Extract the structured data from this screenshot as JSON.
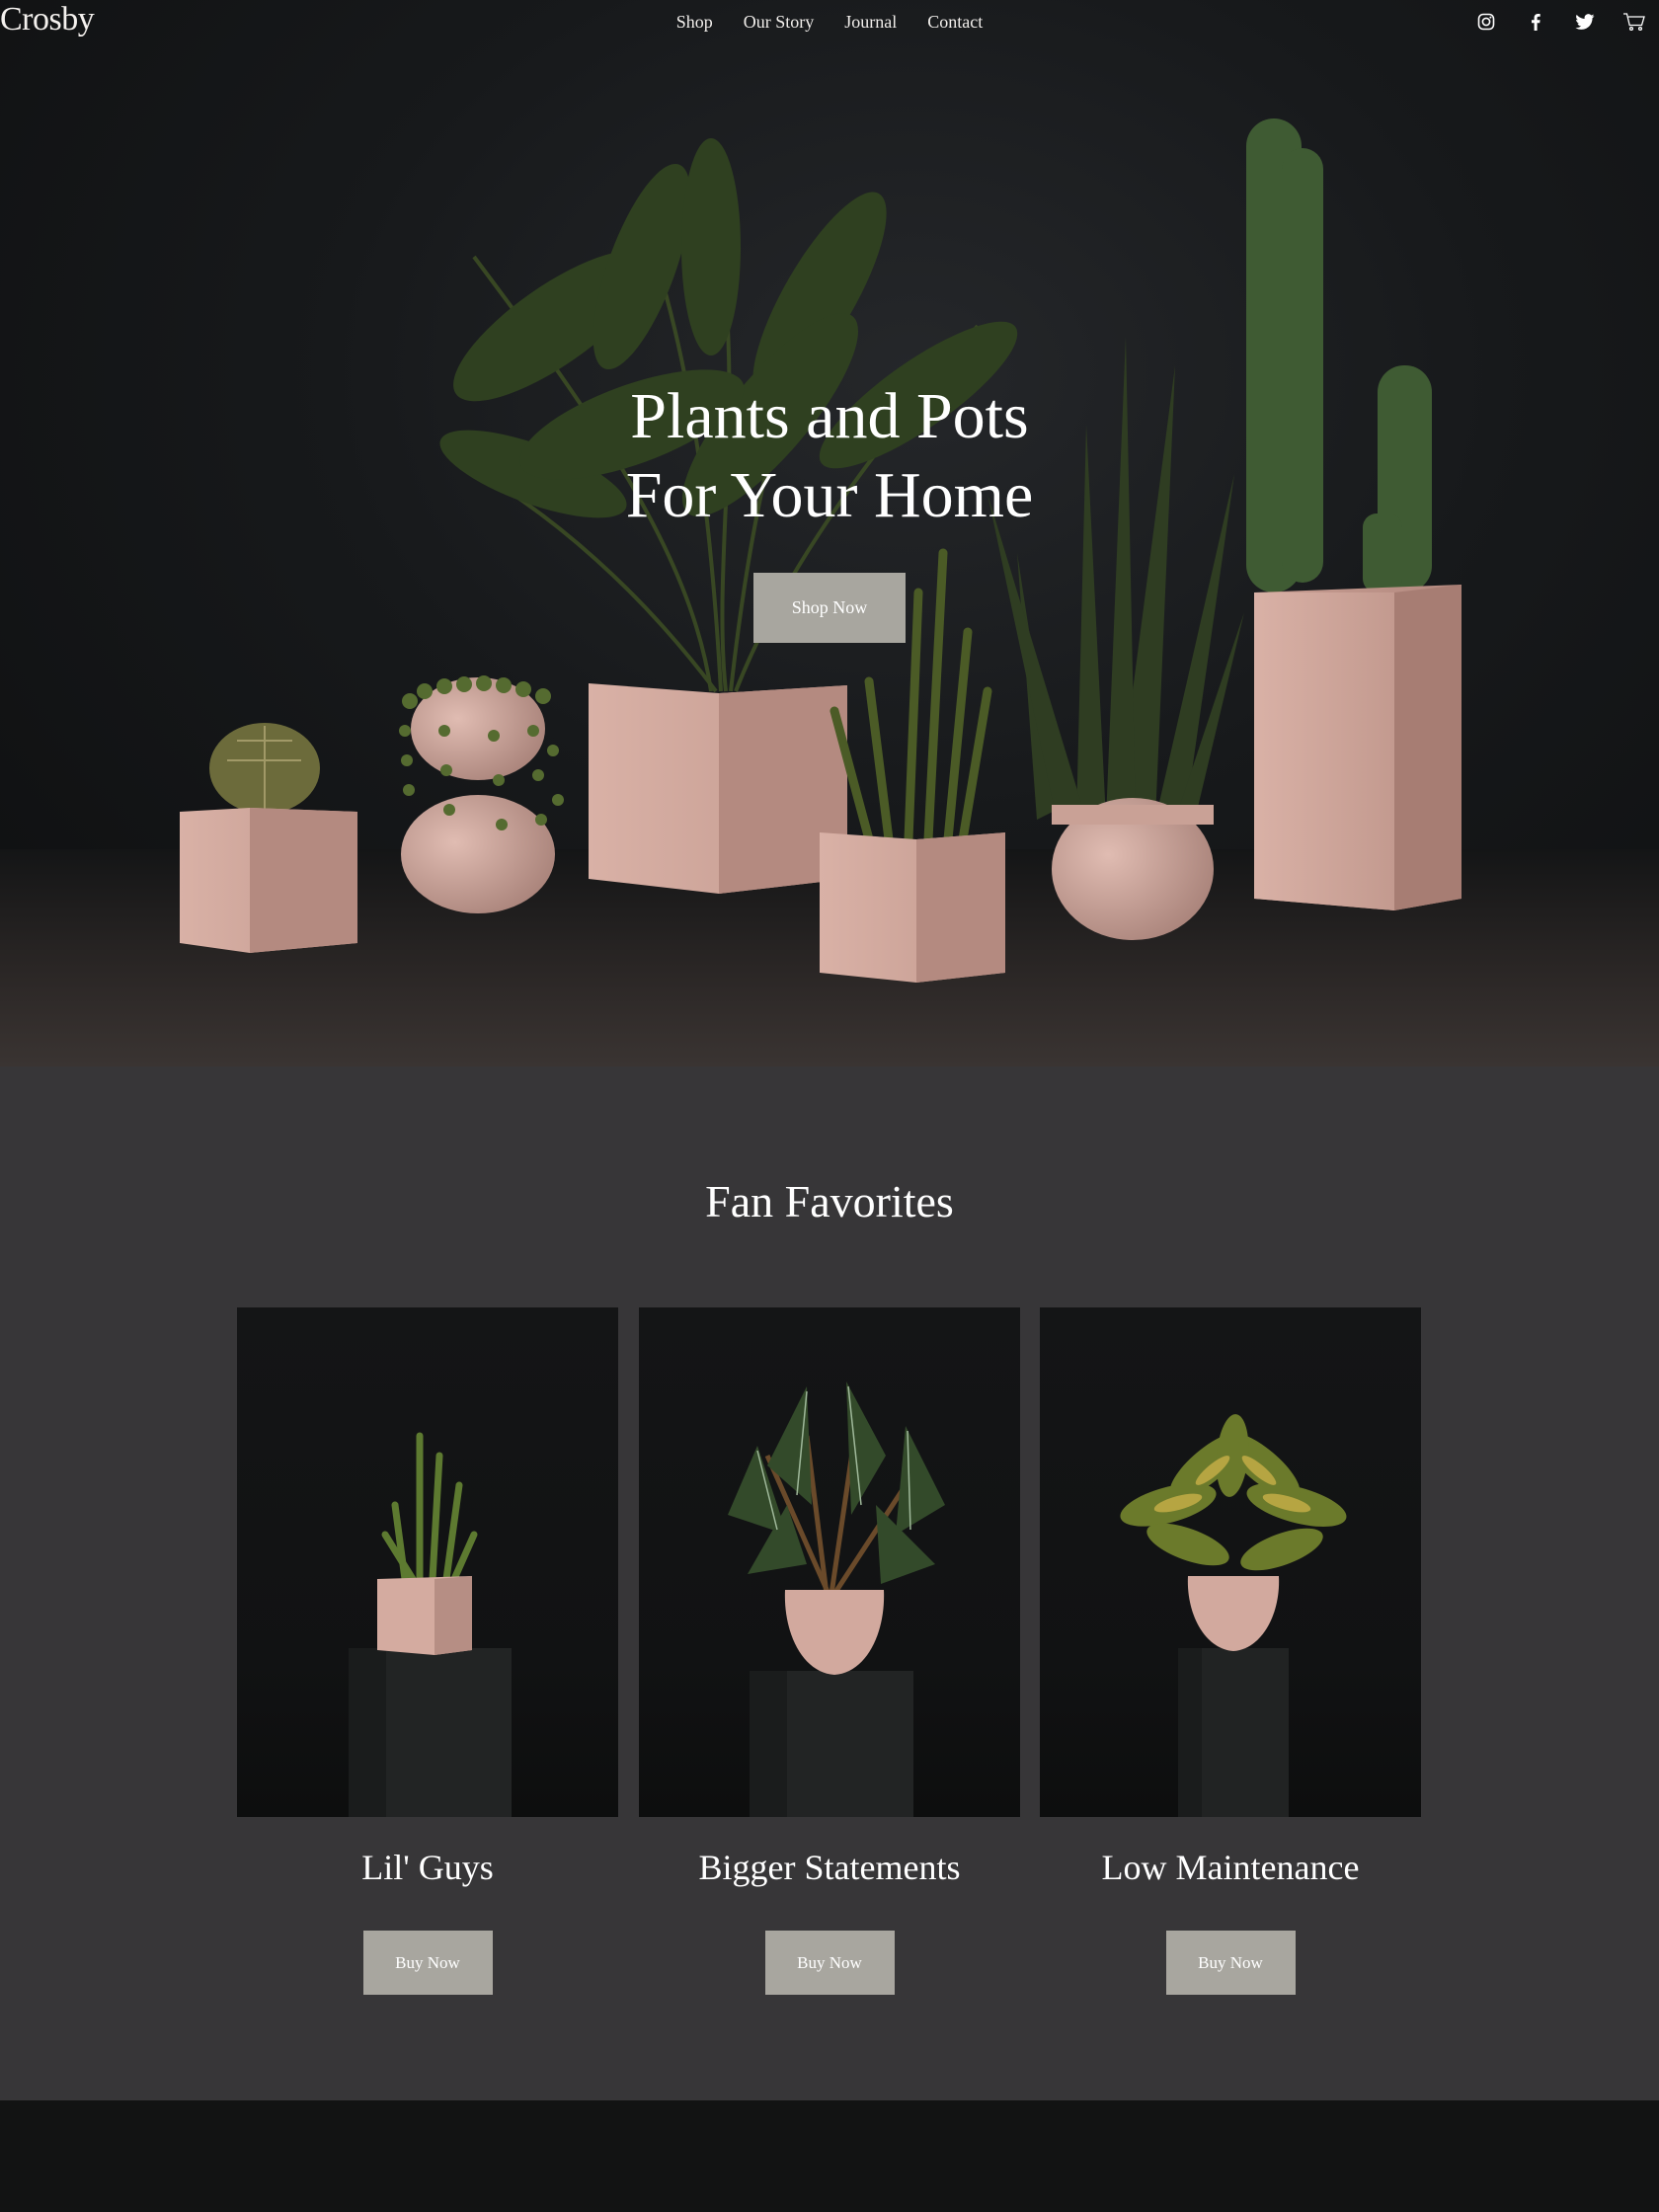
{
  "brand": {
    "name": "Crosby"
  },
  "nav": {
    "items": [
      {
        "label": "Shop"
      },
      {
        "label": "Our Story"
      },
      {
        "label": "Journal"
      },
      {
        "label": "Contact"
      }
    ]
  },
  "social": {
    "icons": [
      "instagram-icon",
      "facebook-icon",
      "twitter-icon",
      "cart-icon"
    ]
  },
  "hero": {
    "title_line1": "Plants and Pots",
    "title_line2": "For Your Home",
    "cta_label": "Shop Now"
  },
  "favorites": {
    "title": "Fan Favorites",
    "cards": [
      {
        "name": "Lil' Guys",
        "cta_label": "Buy Now"
      },
      {
        "name": "Bigger Statements",
        "cta_label": "Buy Now"
      },
      {
        "name": "Low Maintenance",
        "cta_label": "Buy Now"
      }
    ]
  },
  "colors": {
    "hero_bg": "#17191b",
    "section_bg": "#373638",
    "button_bg": "#a8a69f",
    "pot": "#d6aea3",
    "plant": "#3f5a2c",
    "footer_bg": "#121313"
  }
}
